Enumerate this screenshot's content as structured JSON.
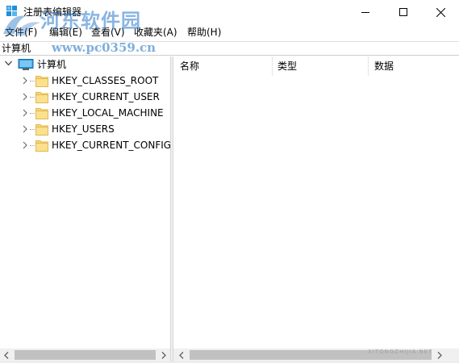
{
  "window": {
    "title": "注册表编辑器",
    "icons": {
      "app": "registry-editor-icon",
      "minimize": "minimize-icon",
      "maximize": "maximize-icon",
      "close": "close-icon"
    }
  },
  "watermark": {
    "site_name": "河东软件园",
    "url": "www.pc0359.cn",
    "bottom_text": "XITONGZHIJIA.NET"
  },
  "menu": {
    "items": [
      {
        "label": "文件(F)"
      },
      {
        "label": "编辑(E)"
      },
      {
        "label": "查看(V)"
      },
      {
        "label": "收藏夹(A)"
      },
      {
        "label": "帮助(H)"
      }
    ]
  },
  "address": {
    "value": "计算机"
  },
  "tree": {
    "root": {
      "label": "计算机",
      "icon": "computer-icon",
      "expanded": true
    },
    "children": [
      {
        "label": "HKEY_CLASSES_ROOT",
        "icon": "folder-icon"
      },
      {
        "label": "HKEY_CURRENT_USER",
        "icon": "folder-icon"
      },
      {
        "label": "HKEY_LOCAL_MACHINE",
        "icon": "folder-icon"
      },
      {
        "label": "HKEY_USERS",
        "icon": "folder-icon"
      },
      {
        "label": "HKEY_CURRENT_CONFIG",
        "icon": "folder-icon"
      }
    ]
  },
  "list": {
    "columns": [
      {
        "label": "名称"
      },
      {
        "label": "类型"
      },
      {
        "label": "数据"
      }
    ],
    "rows": []
  },
  "colors": {
    "folder": "#f8d775",
    "folder_dark": "#e8b94a",
    "scroll_thumb": "#c1c1c1",
    "scroll_track": "#f0f0f0",
    "watermark": "#2878c8"
  }
}
